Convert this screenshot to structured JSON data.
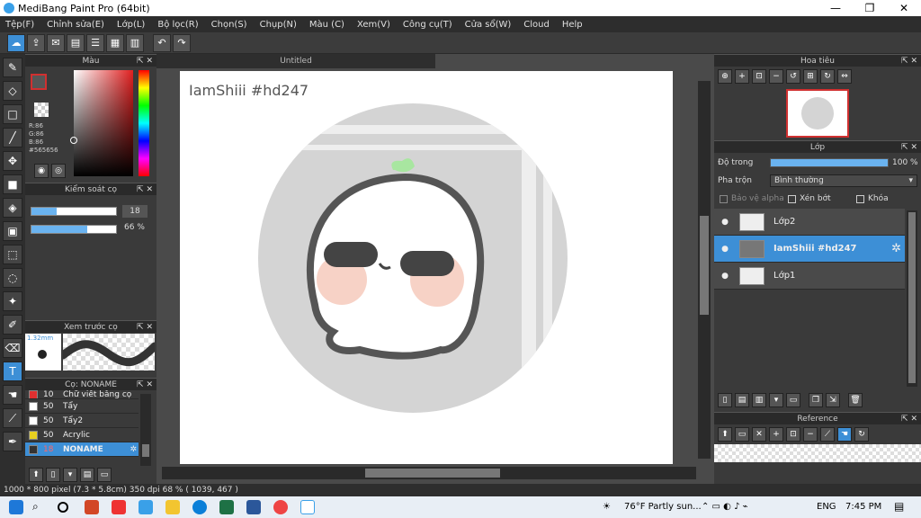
{
  "window": {
    "title": "MediBang Paint Pro (64bit)",
    "min": "—",
    "max": "❐",
    "close": "✕"
  },
  "menu": [
    "Tệp(F)",
    "Chỉnh sửa(E)",
    "Lớp(L)",
    "Bộ lọc(R)",
    "Chọn(S)",
    "Chụp(N)",
    "Màu (C)",
    "Xem(V)",
    "Công cụ(T)",
    "Cửa sổ(W)",
    "Cloud",
    "Help"
  ],
  "color_panel": {
    "title": "Màu",
    "r": "R:86",
    "g": "G:86",
    "b": "B:86",
    "hex": "#565656",
    "primary": "#565656"
  },
  "brush_control": {
    "title": "Kiểm soát cọ",
    "size_value": "18",
    "size_fraction": 0.3,
    "opacity_value": "66 %",
    "opacity_fraction": 0.66
  },
  "brush_preview": {
    "title": "Xem trước cọ",
    "size_label": "1.32mm"
  },
  "brush_list": {
    "title": "Cọ: NONAME",
    "items": [
      {
        "size": "10",
        "name": "Chữ viết bằng cọ",
        "swatch": "#e03030"
      },
      {
        "size": "50",
        "name": "Tẩy",
        "swatch": "#ffffff"
      },
      {
        "size": "50",
        "name": "Tẩy2",
        "swatch": "#ffffff"
      },
      {
        "size": "50",
        "name": "Acrylic",
        "swatch": "#e8d020"
      },
      {
        "size": "18",
        "name": "NONAME",
        "swatch": "#333333",
        "selected": true
      }
    ]
  },
  "canvas": {
    "tab": "Untitled",
    "text": "IamShiii #hd247"
  },
  "navigator": {
    "title": "Hoa tiêu"
  },
  "layers": {
    "title": "Lớp",
    "opacity_label": "Độ trong",
    "opacity_value": "100 %",
    "opacity_fraction": 1.0,
    "blend_label": "Pha trộn",
    "blend_value": "Bình thường",
    "protect_alpha": "Bảo vệ alpha",
    "clipping": "Xén bớt",
    "lock": "Khóa",
    "items": [
      {
        "name": "Lớp2",
        "selected": false
      },
      {
        "name": "IamShiii #hd247",
        "selected": true
      },
      {
        "name": "Lớp1",
        "selected": false
      }
    ]
  },
  "reference": {
    "title": "Reference"
  },
  "status": "1000 * 800 pixel  (7.3 * 5.8cm)  350 dpi  68 %  ( 1039, 467 )",
  "taskbar": {
    "weather": "76°F  Partly sun...",
    "lang": "ENG",
    "time": "7:45 PM"
  }
}
